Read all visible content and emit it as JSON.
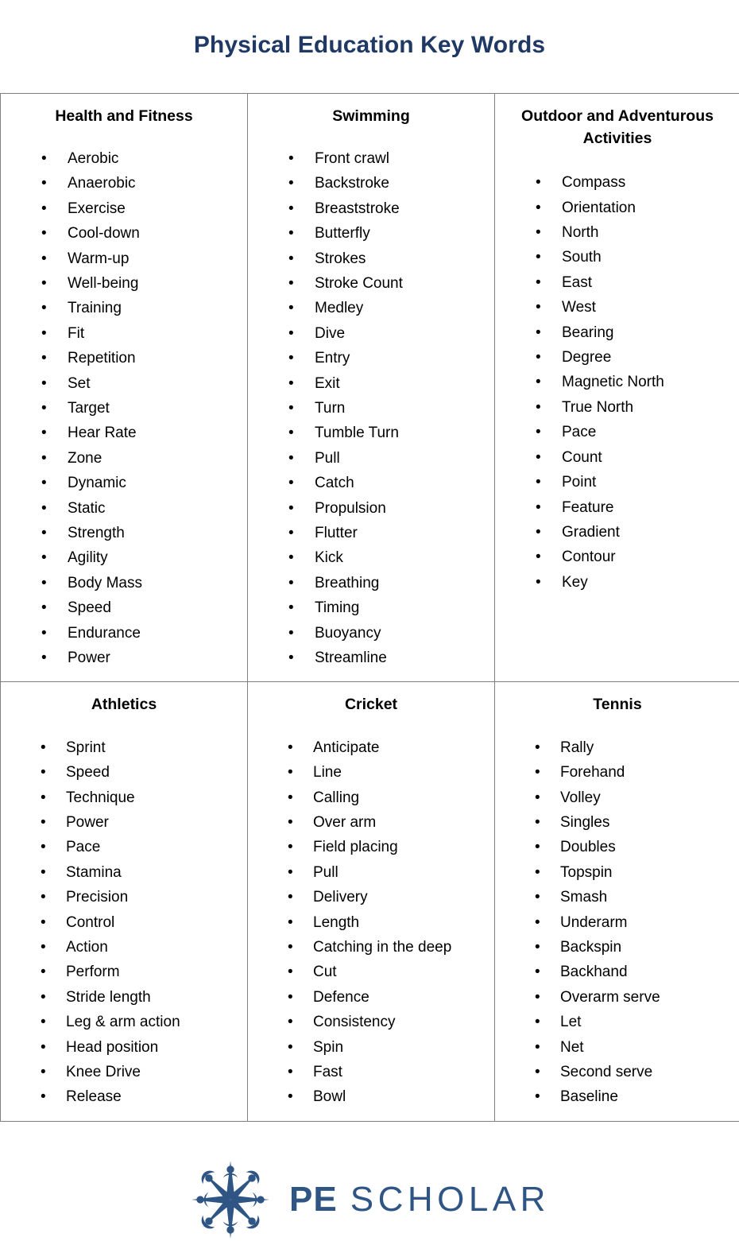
{
  "document": {
    "title": "Physical Education Key Words",
    "title_color": "#1F3864"
  },
  "table": {
    "bullet_glyph": "•",
    "border_color": "#7F7F7F",
    "rows": [
      {
        "cells": [
          {
            "header": "Health and Fitness",
            "items": [
              "Aerobic",
              "Anaerobic",
              "Exercise",
              "Cool-down",
              "Warm-up",
              "Well-being",
              "Training",
              "Fit",
              "Repetition",
              "Set",
              "Target",
              "Hear Rate",
              "Zone",
              "Dynamic",
              "Static",
              "Strength",
              "Agility",
              "Body Mass",
              "Speed",
              "Endurance",
              "Power"
            ]
          },
          {
            "header": "Swimming",
            "items": [
              "Front crawl",
              "Backstroke",
              "Breaststroke",
              "Butterfly",
              "Strokes",
              "Stroke Count",
              "Medley",
              "Dive",
              "Entry",
              "Exit",
              "Turn",
              "Tumble Turn",
              "Pull",
              "Catch",
              "Propulsion",
              "Flutter",
              "Kick",
              "Breathing",
              "Timing",
              "Buoyancy",
              "Streamline"
            ]
          },
          {
            "header": "Outdoor and Adventurous Activities",
            "items": [
              "Compass",
              "Orientation",
              "North",
              "South",
              "East",
              "West",
              "Bearing",
              "Degree",
              "Magnetic North",
              "True North",
              "Pace",
              "Count",
              "Point",
              "Feature",
              "Gradient",
              "Contour",
              "Key"
            ]
          }
        ]
      },
      {
        "cells": [
          {
            "header": "Athletics",
            "items": [
              "Sprint",
              "Speed",
              "Technique",
              "Power",
              "Pace",
              "Stamina",
              "Precision",
              "Control",
              "Action",
              "Perform",
              "Stride length",
              "Leg & arm action",
              "Head position",
              "Knee Drive",
              "Release"
            ]
          },
          {
            "header": "Cricket",
            "items": [
              "Anticipate",
              "Line",
              "Calling",
              "Over arm",
              "Field placing",
              "Pull",
              "Delivery",
              "Length",
              "Catching in the deep",
              "Cut",
              "Defence",
              "Consistency",
              "Spin",
              "Fast",
              "Bowl"
            ]
          },
          {
            "header": "Tennis",
            "items": [
              "Rally",
              "Forehand",
              "Volley",
              "Singles",
              "Doubles",
              "Topspin",
              "Smash",
              "Underarm",
              "Backspin",
              "Backhand",
              "Overarm serve",
              "Let",
              "Net",
              "Second serve",
              "Baseline"
            ]
          }
        ]
      }
    ]
  },
  "footer": {
    "logo_icon": "compass-star-icon",
    "brand_primary": "PE",
    "brand_secondary": "SCHOLAR",
    "brand_color": "#2E5584"
  }
}
